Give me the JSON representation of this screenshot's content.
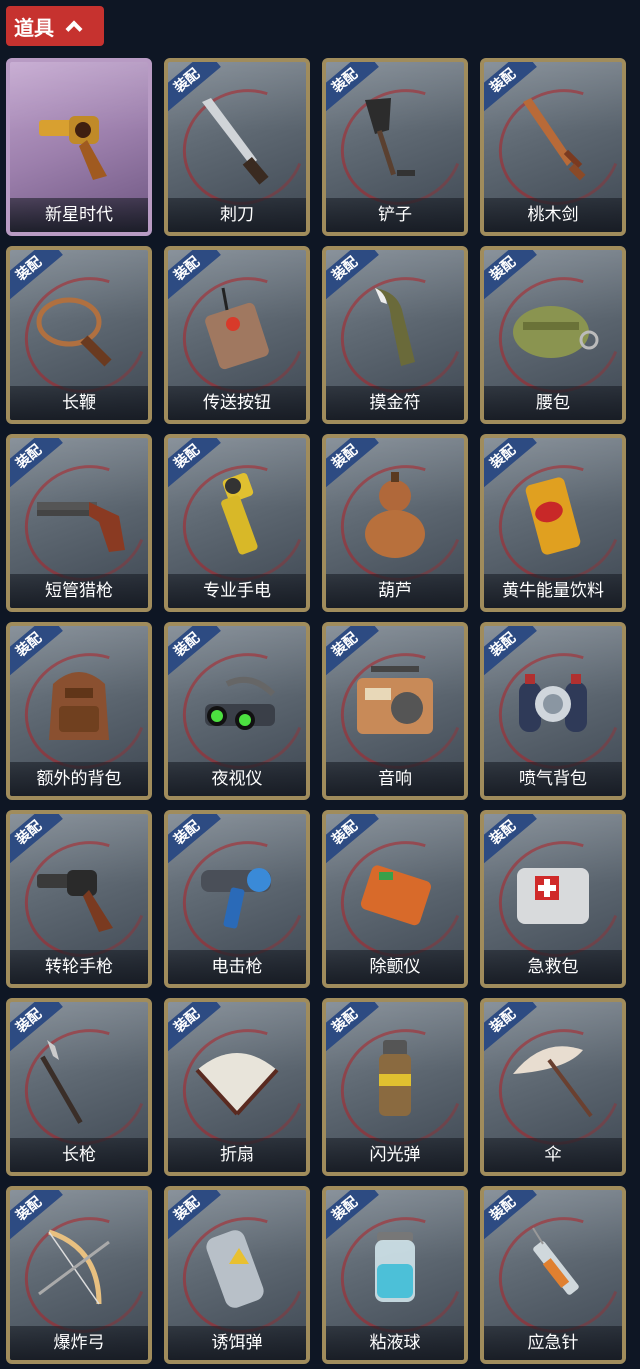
{
  "header": {
    "title": "道具"
  },
  "equip_badge": "装配",
  "items": [
    {
      "label": "新星时代",
      "icon": "revolver-golden-icon",
      "equipped": false,
      "selected": true
    },
    {
      "label": "刺刀",
      "icon": "bayonet-icon",
      "equipped": true
    },
    {
      "label": "铲子",
      "icon": "shovel-icon",
      "equipped": true
    },
    {
      "label": "桃木剑",
      "icon": "peachwood-sword-icon",
      "equipped": true
    },
    {
      "label": "长鞭",
      "icon": "whip-icon",
      "equipped": true
    },
    {
      "label": "传送按钮",
      "icon": "teleport-button-icon",
      "equipped": true
    },
    {
      "label": "摸金符",
      "icon": "talisman-icon",
      "equipped": true
    },
    {
      "label": "腰包",
      "icon": "waist-pack-icon",
      "equipped": true
    },
    {
      "label": "短管猎枪",
      "icon": "shotgun-icon",
      "equipped": true
    },
    {
      "label": "专业手电",
      "icon": "flashlight-icon",
      "equipped": true
    },
    {
      "label": "葫芦",
      "icon": "gourd-icon",
      "equipped": true
    },
    {
      "label": "黄牛能量饮料",
      "icon": "energy-drink-icon",
      "equipped": true
    },
    {
      "label": "额外的背包",
      "icon": "backpack-icon",
      "equipped": true
    },
    {
      "label": "夜视仪",
      "icon": "night-vision-icon",
      "equipped": true
    },
    {
      "label": "音响",
      "icon": "radio-icon",
      "equipped": true
    },
    {
      "label": "喷气背包",
      "icon": "jetpack-icon",
      "equipped": true
    },
    {
      "label": "转轮手枪",
      "icon": "revolver-icon",
      "equipped": true
    },
    {
      "label": "电击枪",
      "icon": "shock-gun-icon",
      "equipped": true
    },
    {
      "label": "除颤仪",
      "icon": "defibrillator-icon",
      "equipped": true
    },
    {
      "label": "急救包",
      "icon": "first-aid-kit-icon",
      "equipped": true
    },
    {
      "label": "长枪",
      "icon": "spear-icon",
      "equipped": true
    },
    {
      "label": "折扇",
      "icon": "folding-fan-icon",
      "equipped": true
    },
    {
      "label": "闪光弹",
      "icon": "flashbang-icon",
      "equipped": true
    },
    {
      "label": "伞",
      "icon": "umbrella-icon",
      "equipped": true
    },
    {
      "label": "爆炸弓",
      "icon": "explosive-bow-icon",
      "equipped": true
    },
    {
      "label": "诱饵弹",
      "icon": "decoy-grenade-icon",
      "equipped": true
    },
    {
      "label": "粘液球",
      "icon": "slime-ball-icon",
      "equipped": true
    },
    {
      "label": "应急针",
      "icon": "emergency-syringe-icon",
      "equipped": true
    }
  ]
}
